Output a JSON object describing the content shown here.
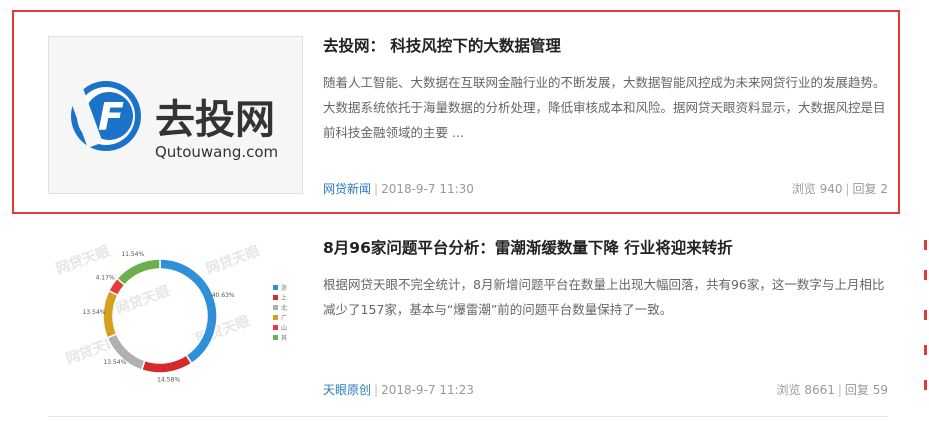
{
  "articles": [
    {
      "title": "去投网：  科技风控下的大数据管理",
      "summary": "随着人工智能、大数据在互联网金融行业的不断发展，大数据智能风控成为未来网贷行业的发展趋势。大数据系统依托于海量数据的分析处理，降低审核成本和风险。据网贷天眼资料显示，大数据风控是目前科技金融领域的主要 ...",
      "category": "网贷新闻",
      "datetime": "2018-9-7 11:30",
      "views_text": "浏览 940",
      "replies_text": "回复 2",
      "thumb": {
        "logo_cn": "去投网",
        "logo_en": "Qutouwang.com",
        "logo_letter": "F",
        "colors": {
          "primary": "#1a73c8",
          "text": "#333333"
        }
      }
    },
    {
      "title": "8月96家问题平台分析：雷潮渐缓数量下降 行业将迎来转折",
      "summary": "根据网贷天眼不完全统计，8月新增问题平台在数量上出现大幅回落，共有96家，这一数字与上月相比减少了157家，基本与“爆雷潮”前的问题平台数量保持了一致。",
      "category": "天眼原创",
      "datetime": "2018-9-7 11:23",
      "views_text": "浏览 8661",
      "replies_text": "回复 59",
      "thumb": {
        "watermark": "网贷天眼",
        "slice_labels": [
          "40.63%",
          "14.58%",
          "13.54%",
          "13.54%",
          "4.17%",
          "11.54%"
        ],
        "slice_values": [
          40.63,
          14.58,
          13.54,
          13.54,
          4.17,
          13.54
        ],
        "slice_colors": [
          "#2f8fd8",
          "#d42a2a",
          "#b0b0b0",
          "#d4a01e",
          "#e83a3a",
          "#6ab04c"
        ],
        "legend": [
          "浙",
          "上",
          "北",
          "广",
          "山",
          "其"
        ]
      }
    }
  ],
  "colors": {
    "highlight_border": "#e2393a",
    "category_link": "#2b7bc0"
  }
}
